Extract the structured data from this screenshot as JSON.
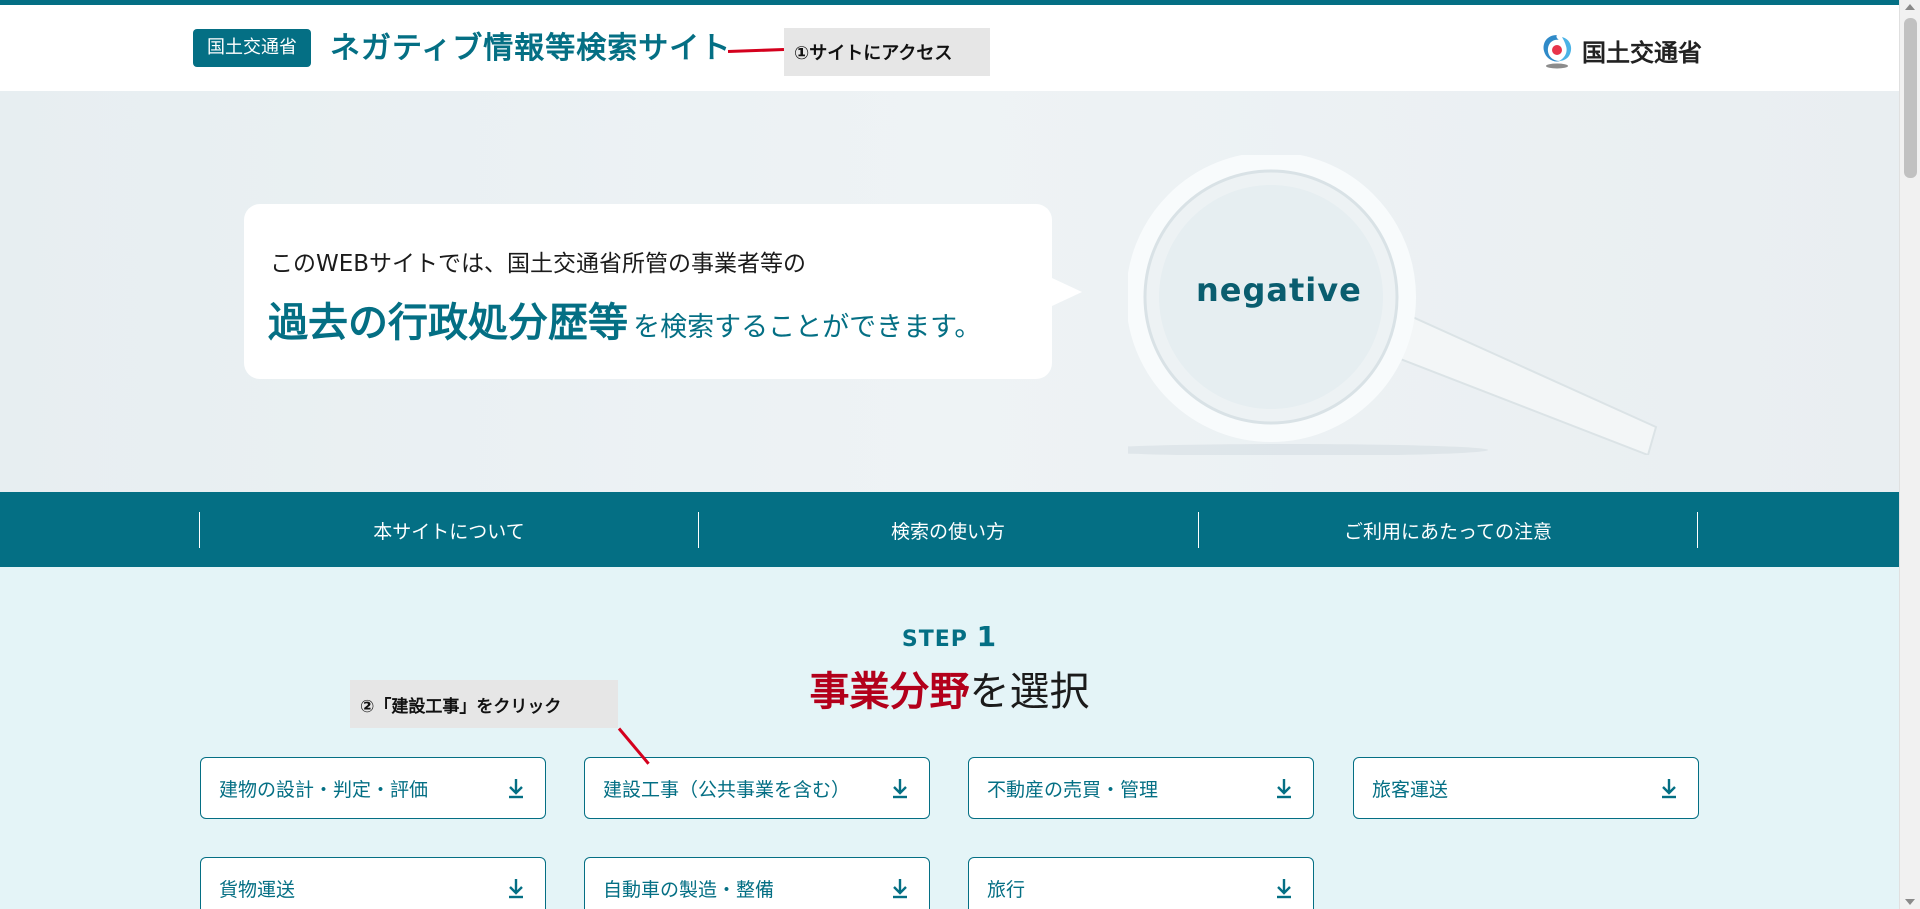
{
  "header": {
    "badge": "国土交通省",
    "title": "ネガティブ情報等検索サイト",
    "logo_text": "国土交通省",
    "logo_icon": "mlit-logo-icon"
  },
  "annotations": {
    "step1": "①サイトにアクセス",
    "step2": "②「建設工事」をクリック"
  },
  "hero": {
    "line1": "このWEBサイトでは、国土交通省所管の事業者等の",
    "line2_strong": "過去の行政処分歴等",
    "line2_rest": "を検索することができます。",
    "magnifier_word": "negative"
  },
  "nav": {
    "items": [
      "本サイトについて",
      "検索の使い方",
      "ご利用にあたっての注意"
    ]
  },
  "main": {
    "step_label": "STEP",
    "step_number": "1",
    "title_accent": "事業分野",
    "title_rest": "を選択",
    "categories": [
      "建物の設計・判定・評価",
      "建設工事（公共事業を含む）",
      "不動産の売買・管理",
      "旅客運送",
      "貨物運送",
      "自動車の製造・整備",
      "旅行"
    ],
    "category_icon": "download-arrow-icon"
  },
  "colors": {
    "brand": "#046f84",
    "accent_red": "#b3001b",
    "annotation_line": "#d4001d",
    "main_bg": "#e4f4f7"
  }
}
